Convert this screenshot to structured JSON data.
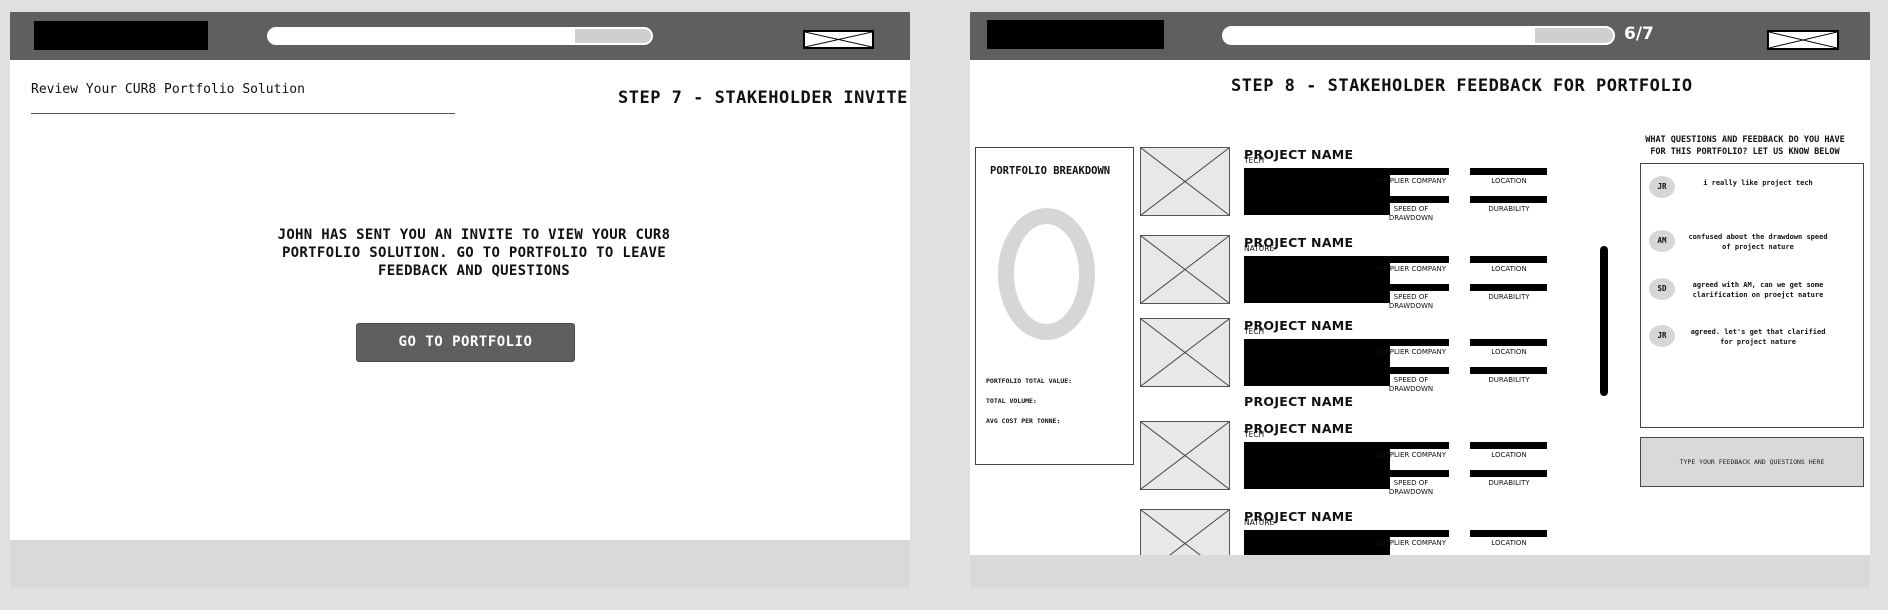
{
  "left_screen": {
    "review_title": "Review Your CUR8 Portfolio Solution",
    "step_title": "STEP 7 - STAKEHOLDER INVITE",
    "progress": 0.8,
    "invite_message": "JOHN HAS SENT YOU AN INVITE TO VIEW YOUR CUR8 PORTFOLIO SOLUTION. GO TO PORTFOLIO TO LEAVE FEEDBACK AND QUESTIONS",
    "go_button_label": "GO TO PORTFOLIO"
  },
  "right_screen": {
    "step_count": "6/7",
    "progress": 0.8,
    "step_title": "STEP 8 - STAKEHOLDER FEEDBACK FOR PORTFOLIO",
    "breakdown": {
      "title": "PORTFOLIO BREAKDOWN",
      "total_value_label": "PORTFOLIO TOTAL VALUE:",
      "total_volume_label": "TOTAL VOLUME:",
      "avg_cost_label": "AVG COST PER TONNE:"
    },
    "project_name": "PROJECT NAME",
    "attribute_labels": {
      "supplier": "SUPPLIER COMPANY",
      "location": "LOCATION",
      "speed": "SPEED OF DRAWDOWN",
      "durability": "DURABILITY"
    },
    "projects": [
      {
        "name": "PROJECT NAME",
        "category": "TECH"
      },
      {
        "name": "PROJECT NAME",
        "category": "NATURE"
      },
      {
        "name": "PROJECT NAME",
        "category": "TECH"
      },
      {
        "name": "PROJECT NAME",
        "category": "TECH"
      },
      {
        "name": "PROJECT NAME",
        "category": "NATURE"
      }
    ],
    "feedback_heading": "WHAT QUESTIONS AND FEEDBACK DO YOU HAVE FOR THIS PORTFOLIO? LET US KNOW BELOW",
    "comments": [
      {
        "initials": "JR",
        "text": "i really like project tech"
      },
      {
        "initials": "AM",
        "text": "confused about the drawdown speed of project nature"
      },
      {
        "initials": "SD",
        "text": "agreed with AM, can we get some clarification on proejct nature"
      },
      {
        "initials": "JR",
        "text": "agreed. let's get that clarified for project nature"
      }
    ],
    "feedback_placeholder": "TYPE YOUR FEEDBACK AND QUESTIONS HERE"
  }
}
